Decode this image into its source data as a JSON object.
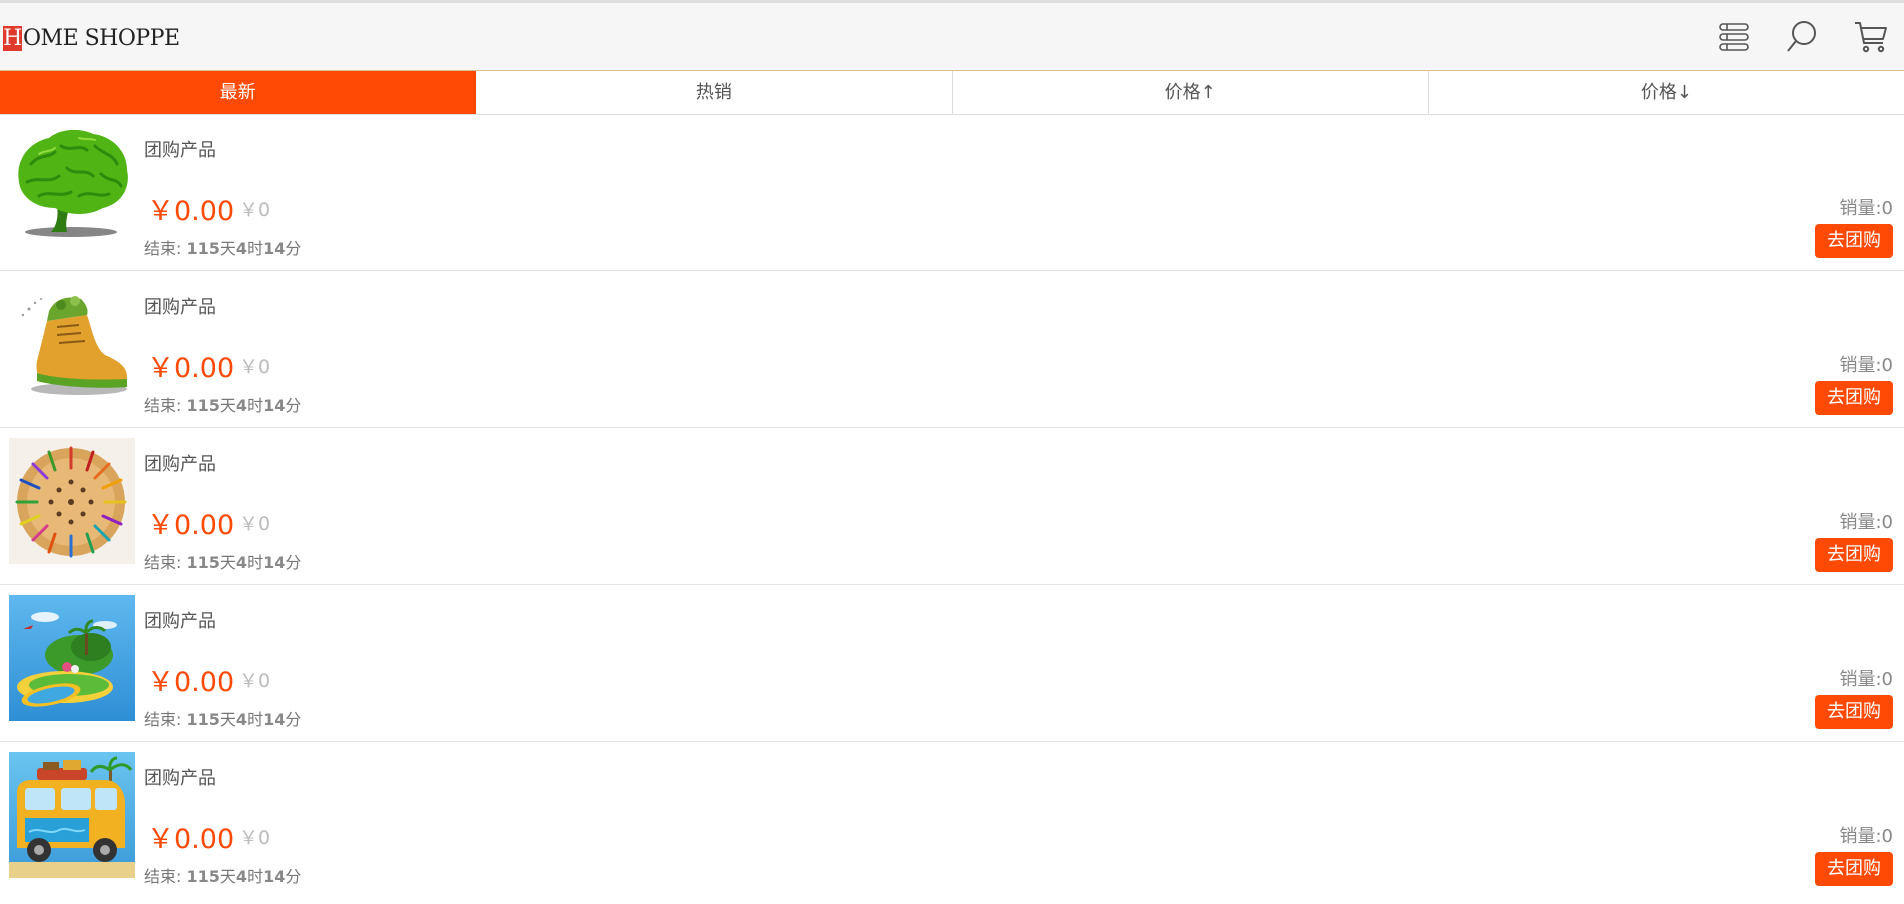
{
  "header": {
    "logo_first": "H",
    "logo_rest": "OME SHOPPE",
    "icons": [
      "list-icon",
      "search-icon",
      "cart-icon"
    ]
  },
  "tabs": [
    {
      "label": "最新",
      "active": true
    },
    {
      "label": "热销",
      "active": false
    },
    {
      "label": "价格↑",
      "active": false
    },
    {
      "label": "价格↓",
      "active": false
    }
  ],
  "products": [
    {
      "image": "green-brain",
      "name": "团购产品",
      "price": "￥0.00",
      "original_price": "￥0",
      "end_label": "结束:",
      "days": "115",
      "days_unit": "天",
      "hours": "4",
      "hours_unit": "时",
      "minutes": "14",
      "minutes_unit": "分",
      "sales": "销量:0",
      "button": "去团购"
    },
    {
      "image": "grass-boot",
      "name": "团购产品",
      "price": "￥0.00",
      "original_price": "￥0",
      "end_label": "结束:",
      "days": "115",
      "days_unit": "天",
      "hours": "4",
      "hours_unit": "时",
      "minutes": "14",
      "minutes_unit": "分",
      "sales": "销量:0",
      "button": "去团购"
    },
    {
      "image": "pencil-sphere",
      "name": "团购产品",
      "price": "￥0.00",
      "original_price": "￥0",
      "end_label": "结束:",
      "days": "115",
      "days_unit": "天",
      "hours": "4",
      "hours_unit": "时",
      "minutes": "14",
      "minutes_unit": "分",
      "sales": "销量:0",
      "button": "去团购"
    },
    {
      "image": "flip-flop-island",
      "name": "团购产品",
      "price": "￥0.00",
      "original_price": "￥0",
      "end_label": "结束:",
      "days": "115",
      "days_unit": "天",
      "hours": "4",
      "hours_unit": "时",
      "minutes": "14",
      "minutes_unit": "分",
      "sales": "销量:0",
      "button": "去团购"
    },
    {
      "image": "beach-van",
      "name": "团购产品",
      "price": "￥0.00",
      "original_price": "￥0",
      "end_label": "结束:",
      "days": "115",
      "days_unit": "天",
      "hours": "4",
      "hours_unit": "时",
      "minutes": "14",
      "minutes_unit": "分",
      "sales": "销量:0",
      "button": "去团购"
    }
  ],
  "colors": {
    "accent": "#ff4a06",
    "header_bg": "#f6f6f6",
    "logo_red": "#e03a2d"
  }
}
